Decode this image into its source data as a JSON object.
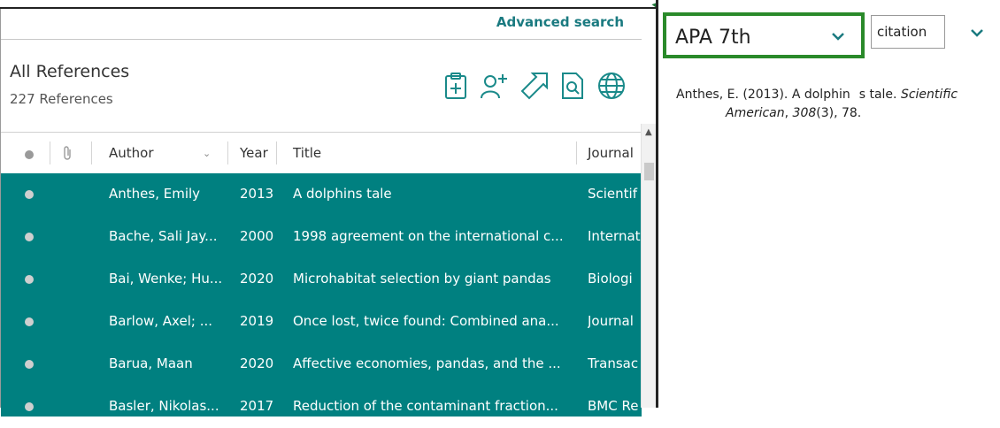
{
  "header": {
    "advanced_search": "Advanced search"
  },
  "library": {
    "title": "All References",
    "count": "227 References"
  },
  "toolbar": {
    "icons": [
      "clipboard-plus-icon",
      "add-person-icon",
      "share-arrow-icon",
      "doc-search-icon",
      "globe-icon"
    ]
  },
  "columns": {
    "author": "Author",
    "year": "Year",
    "title": "Title",
    "journal": "Journal"
  },
  "rows": [
    {
      "author": "Anthes, Emily",
      "year": "2013",
      "title": "A dolphins tale",
      "journal": "Scientif"
    },
    {
      "author": "Bache, Sali Jay...",
      "year": "2000",
      "title": "1998 agreement on the international c...",
      "journal": "Internat"
    },
    {
      "author": "Bai, Wenke; Hu...",
      "year": "2020",
      "title": "Microhabitat selection by giant pandas",
      "journal": "Biologi"
    },
    {
      "author": "Barlow, Axel; ...",
      "year": "2019",
      "title": "Once lost, twice found: Combined ana...",
      "journal": "Journal"
    },
    {
      "author": "Barua, Maan",
      "year": "2020",
      "title": "Affective economies, pandas, and the ...",
      "journal": "Transac"
    },
    {
      "author": "Basler, Nikolas...",
      "year": "2017",
      "title": "Reduction of the contaminant fraction...",
      "journal": "BMC Re"
    }
  ],
  "citation": {
    "style": "APA 7th",
    "mode": "citation",
    "preview_part1": "Anthes, E. (2013). A dolphin",
    "preview_part2": "s tale.",
    "preview_journal": "Scientific",
    "preview_line2_journal": "American",
    "preview_line2_vol": "308",
    "preview_line2_rest": "(3), 78."
  },
  "colors": {
    "teal_row": "#008080",
    "accent": "#1a8a8a",
    "highlight_border": "#2a8a2a"
  }
}
